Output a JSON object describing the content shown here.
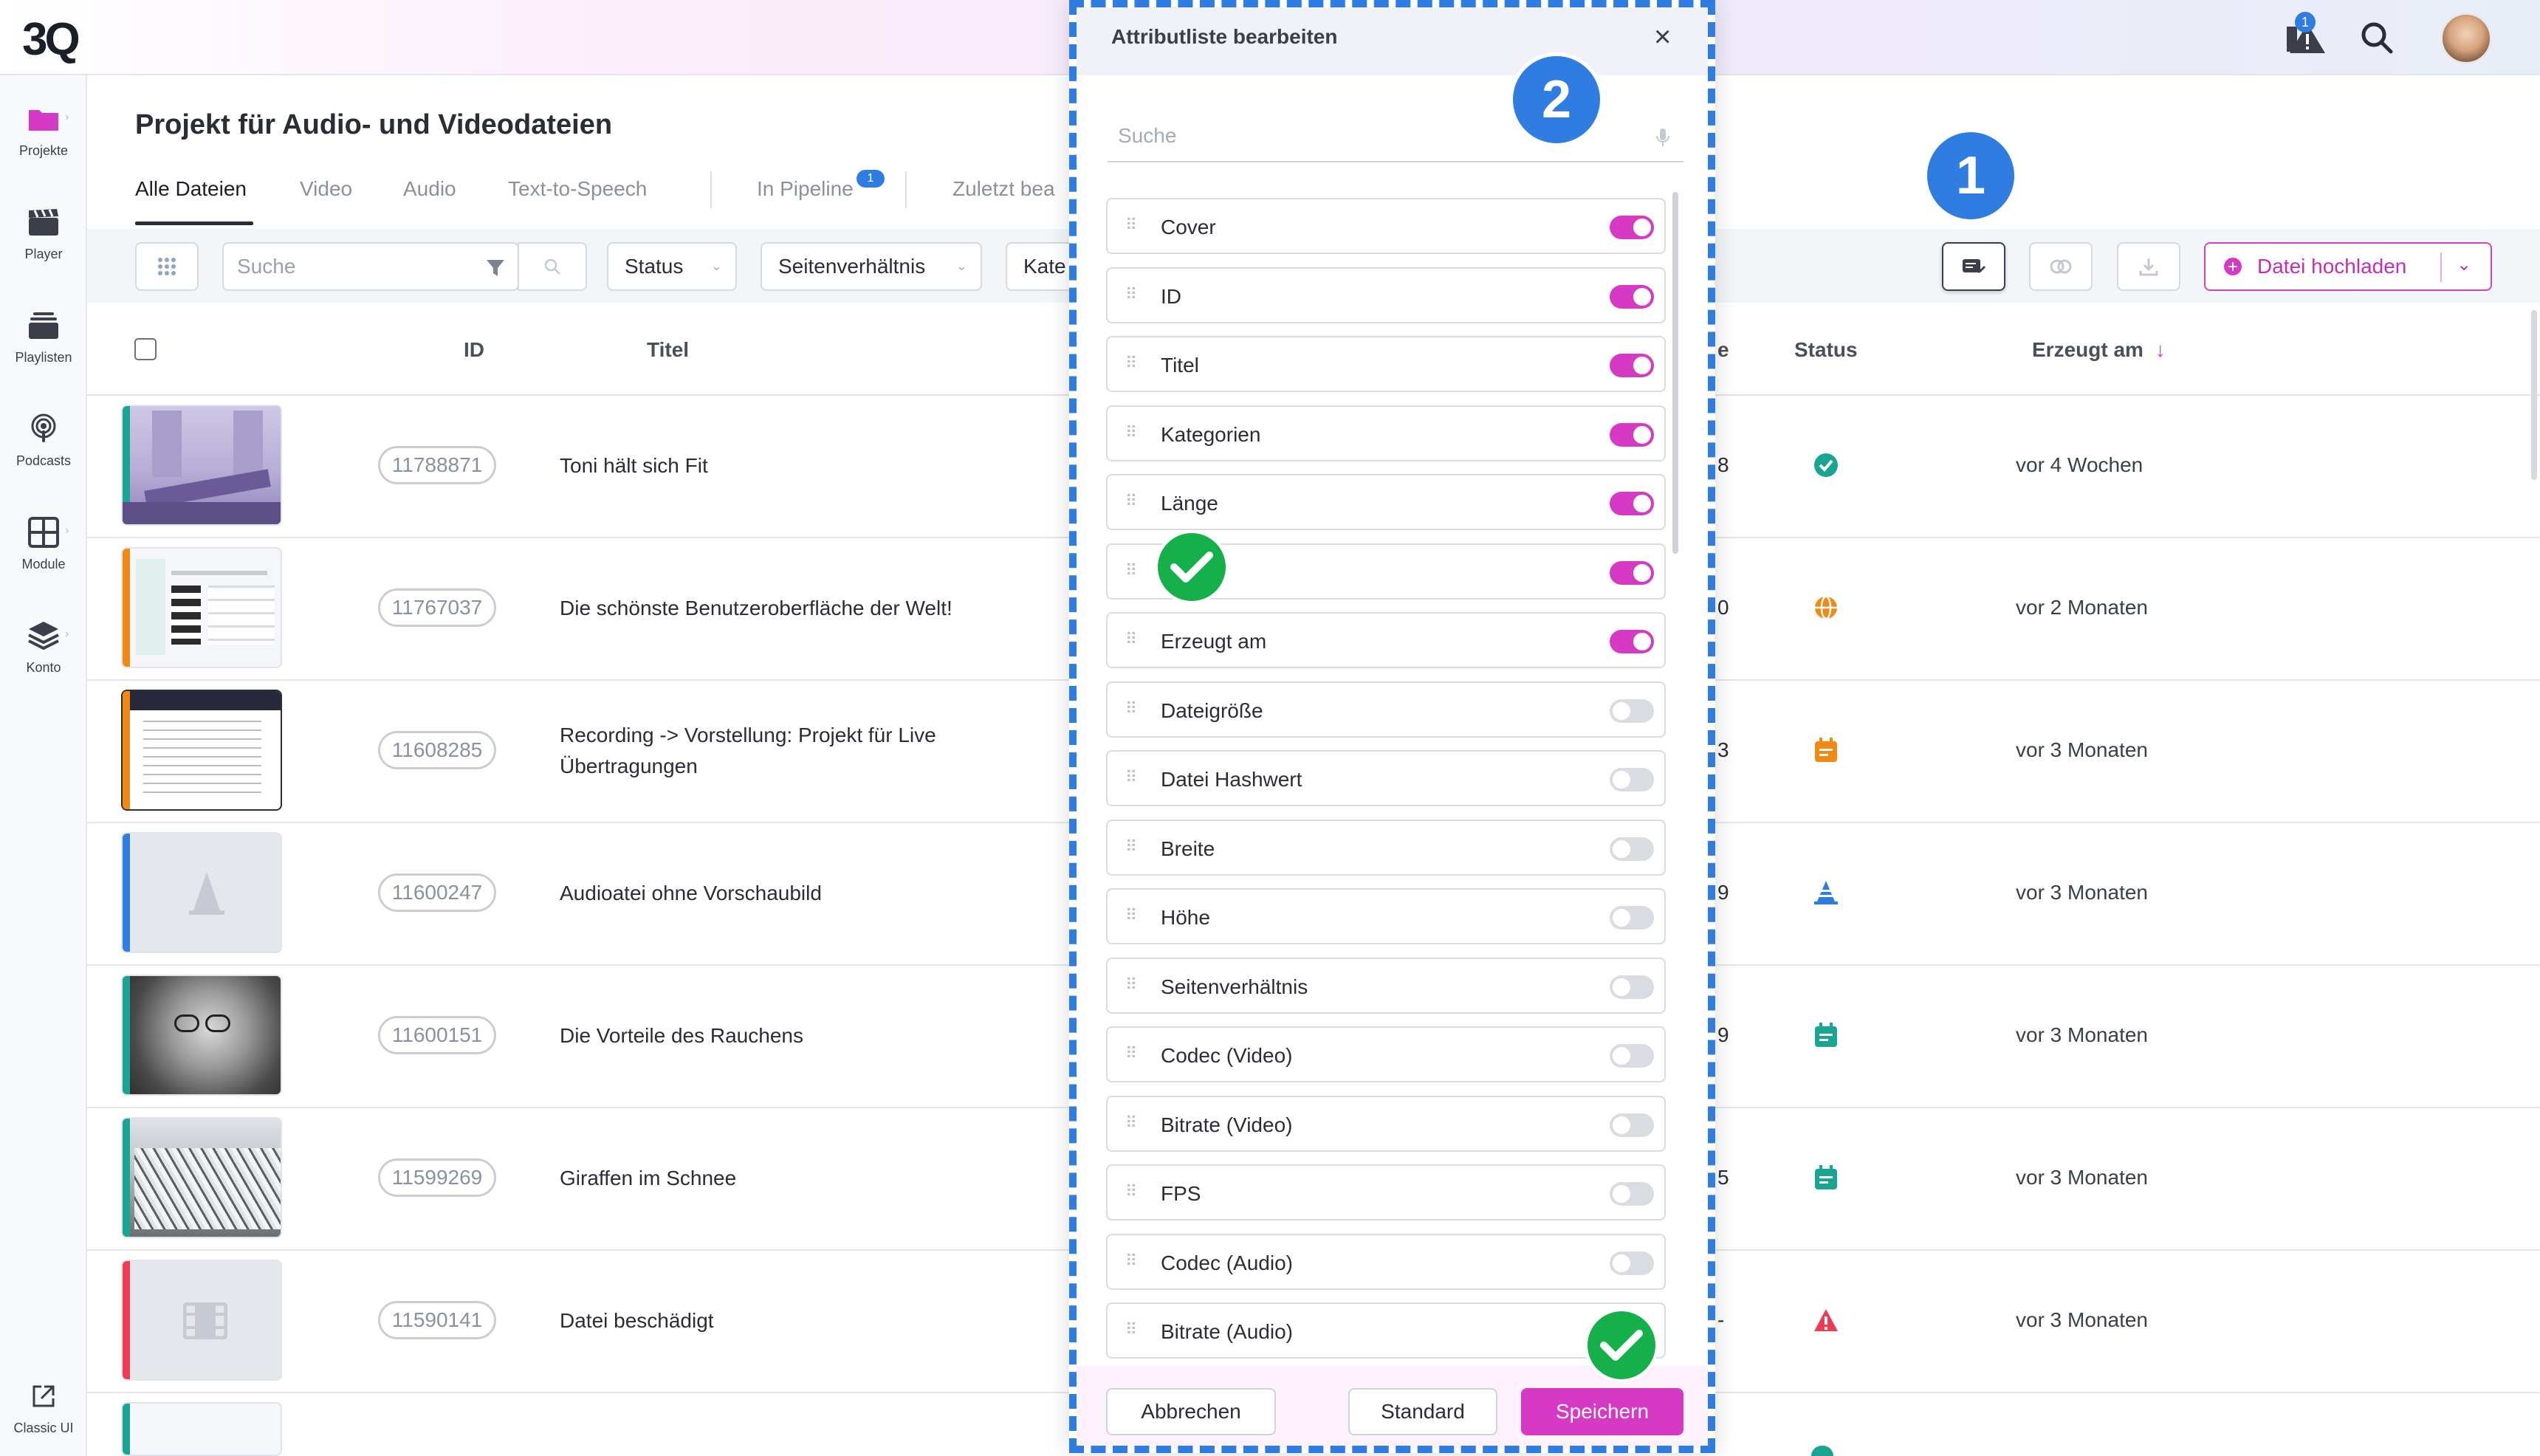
{
  "app": {
    "logo": "3Q"
  },
  "header": {
    "notification_count": "1"
  },
  "sidebar": {
    "items": [
      {
        "label": "Projekte",
        "icon": "folder-icon"
      },
      {
        "label": "Player",
        "icon": "clapperboard-icon"
      },
      {
        "label": "Playlisten",
        "icon": "playlist-stack-icon"
      },
      {
        "label": "Podcasts",
        "icon": "podcast-icon"
      },
      {
        "label": "Module",
        "icon": "grid-icon"
      },
      {
        "label": "Konto",
        "icon": "layers-icon"
      }
    ],
    "classic": "Classic UI"
  },
  "page": {
    "title": "Projekt für Audio- und Videodateien",
    "tabs": [
      "Alle Dateien",
      "Video",
      "Audio",
      "Text-to-Speech",
      "In Pipeline",
      "Zuletzt bea"
    ],
    "pipeline_badge": "1"
  },
  "toolbar": {
    "search_placeholder": "Suche",
    "filters": [
      "Status",
      "Seitenverhältnis",
      "Kate"
    ],
    "upload_label": "Datei hochladen"
  },
  "table": {
    "columns": {
      "id": "ID",
      "title": "Titel",
      "length": "e",
      "status": "Status",
      "created": "Erzeugt am"
    },
    "rows": [
      {
        "id": "11788871",
        "title": "Toni hält sich Fit",
        "length": "8",
        "status": "check-badge",
        "date": "vor 4 Wochen",
        "color": "#1aa593"
      },
      {
        "id": "11767037",
        "title": "Die schönste Benutzeroberfläche der Welt!",
        "length": "0",
        "status": "globe",
        "date": "vor 2 Monaten",
        "color": "#f08a17"
      },
      {
        "id": "11608285",
        "title": "Recording -> Vorstellung: Projekt für Live",
        "title2": "Übertragungen",
        "length": "3",
        "status": "calendar",
        "date": "vor 3 Monaten",
        "color": "#f08a17"
      },
      {
        "id": "11600247",
        "title": "Audioatei ohne Vorschaubild",
        "length": "9",
        "status": "cone",
        "date": "vor 3 Monaten",
        "color": "#2f7de1"
      },
      {
        "id": "11600151",
        "title": "Die Vorteile des Rauchens",
        "length": "9",
        "status": "calendar",
        "date": "vor 3 Monaten",
        "color": "#1aa593"
      },
      {
        "id": "11599269",
        "title": "Giraffen im Schnee",
        "length": "5",
        "status": "calendar",
        "date": "vor 3 Monaten",
        "color": "#1aa593"
      },
      {
        "id": "11590141",
        "title": "Datei beschädigt",
        "length": "-",
        "status": "warning",
        "date": "vor 3 Monaten",
        "color": "#ef3b54"
      }
    ]
  },
  "modal": {
    "title": "Attributliste bearbeiten",
    "search_placeholder": "Suche",
    "attributes": [
      {
        "label": "Cover",
        "on": true
      },
      {
        "label": "ID",
        "on": true
      },
      {
        "label": "Titel",
        "on": true
      },
      {
        "label": "Kategorien",
        "on": true
      },
      {
        "label": "Länge",
        "on": true
      },
      {
        "label": "",
        "on": true
      },
      {
        "label": "Erzeugt am",
        "on": true
      },
      {
        "label": "Dateigröße",
        "on": false
      },
      {
        "label": "Datei Hashwert",
        "on": false
      },
      {
        "label": "Breite",
        "on": false
      },
      {
        "label": "Höhe",
        "on": false
      },
      {
        "label": "Seitenverhältnis",
        "on": false
      },
      {
        "label": "Codec (Video)",
        "on": false
      },
      {
        "label": "Bitrate (Video)",
        "on": false
      },
      {
        "label": "FPS",
        "on": false
      },
      {
        "label": "Codec (Audio)",
        "on": false
      },
      {
        "label": "Bitrate (Audio)",
        "on": false
      }
    ],
    "cancel": "Abbrechen",
    "standard": "Standard",
    "save": "Speichern"
  },
  "annotations": {
    "badge1": "1",
    "badge2": "2"
  },
  "colors": {
    "accent": "#d63ac4",
    "blue": "#2f7de1",
    "green": "#16b04a"
  }
}
